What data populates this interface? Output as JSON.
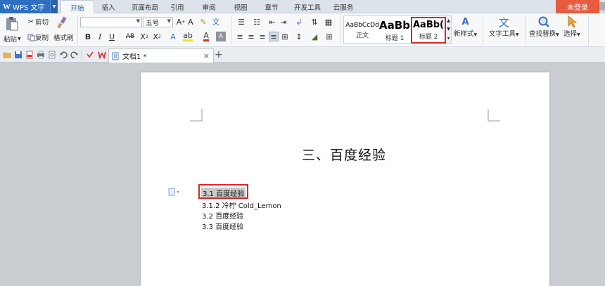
{
  "app": {
    "name": "WPS 文字",
    "logo": "W"
  },
  "menu": {
    "tabs": [
      "开始",
      "插入",
      "页面布局",
      "引用",
      "审阅",
      "视图",
      "章节",
      "开发工具",
      "云服务"
    ],
    "active_tab": "开始",
    "login": "未登录"
  },
  "ribbon": {
    "paste": "粘贴",
    "cut": "剪切",
    "copy": "复制",
    "format_painter": "格式刷",
    "font_size": "五号",
    "font_name": "",
    "styles": [
      {
        "preview": "AaBbCcDd",
        "name": "正文"
      },
      {
        "preview": "AaBb",
        "name": "标题 1"
      },
      {
        "preview": "AaBb(",
        "name": "标题 2"
      }
    ],
    "new_style": "新样式",
    "text_tools": "文字工具",
    "find_replace": "查找替换",
    "select": "选择"
  },
  "doc_tab": {
    "title": "文档1 *"
  },
  "document": {
    "title": "三、百度经验",
    "toc": [
      "3.1 百度经验",
      "3.1.2 冷柠 Cold_Lemon",
      "3.2 百度经验",
      "3.3 百度经验"
    ]
  },
  "colors": {
    "accent": "#2f6fc1",
    "login": "#e85b3f",
    "highlight": "#e02424"
  }
}
